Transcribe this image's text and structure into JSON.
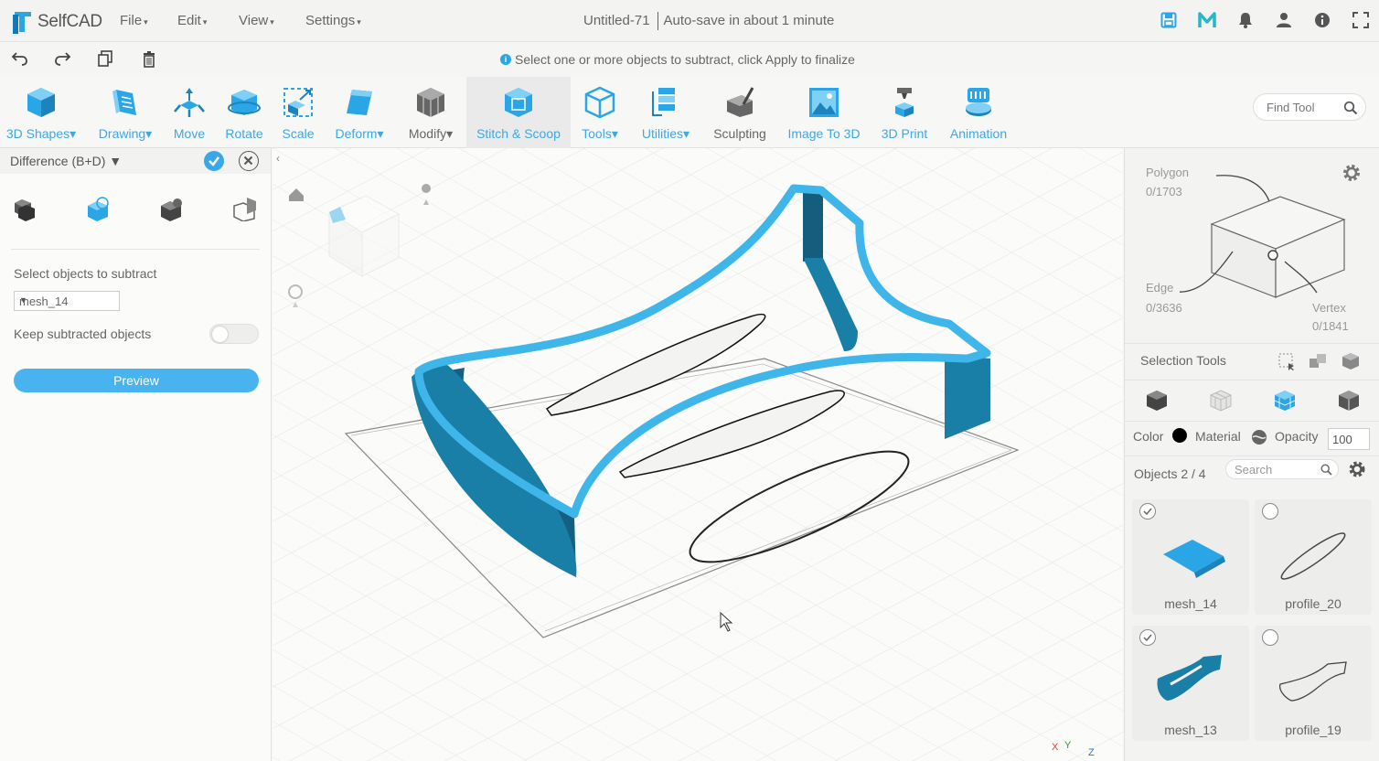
{
  "app": {
    "logo_text": "SelfCAD",
    "menus": [
      "File",
      "Edit",
      "View",
      "Settings"
    ],
    "doc_title": "Untitled-71",
    "autosave": "Auto-save in about 1 minute",
    "top_icons": [
      "save-icon",
      "m-icon",
      "bell-icon",
      "user-icon",
      "info-icon",
      "fullscreen-icon"
    ]
  },
  "actionbar": {
    "hint": "Select one or more objects to subtract, click Apply to finalize",
    "icons": [
      "undo-icon",
      "redo-icon",
      "copy-icon",
      "trash-icon"
    ]
  },
  "toolbar": {
    "tools": [
      {
        "label": "3D Shapes",
        "dropdown": true
      },
      {
        "label": "Drawing",
        "dropdown": true
      },
      {
        "label": "Move",
        "dropdown": false
      },
      {
        "label": "Rotate",
        "dropdown": false
      },
      {
        "label": "Scale",
        "dropdown": false
      },
      {
        "label": "Deform",
        "dropdown": true
      },
      {
        "label": "Modify",
        "dropdown": true
      },
      {
        "label": "Stitch & Scoop",
        "dropdown": false
      },
      {
        "label": "Tools",
        "dropdown": true
      },
      {
        "label": "Utilities",
        "dropdown": true
      },
      {
        "label": "Sculpting",
        "dropdown": false
      },
      {
        "label": "Image To 3D",
        "dropdown": false
      },
      {
        "label": "3D Print",
        "dropdown": false
      },
      {
        "label": "Animation",
        "dropdown": false
      }
    ],
    "find_tool_placeholder": "Find Tool"
  },
  "left_panel": {
    "title": "Difference (B+D)",
    "select_label": "Select objects to subtract",
    "selected_object": "mesh_14",
    "keep_label": "Keep subtracted objects",
    "keep_enabled": false,
    "preview_label": "Preview"
  },
  "right_panel": {
    "polygon_label": "Polygon",
    "polygon_count": "0/1703",
    "edge_label": "Edge",
    "edge_count": "0/3636",
    "vertex_label": "Vertex",
    "vertex_count": "0/1841",
    "selection_tools_label": "Selection Tools",
    "color_label": "Color",
    "color_value": "#000000",
    "material_label": "Material",
    "opacity_label": "Opacity",
    "opacity_value": "100",
    "objects_label": "Objects 2 / 4",
    "search_placeholder": "Search",
    "objects": [
      {
        "name": "mesh_14",
        "checked": true
      },
      {
        "name": "profile_20",
        "checked": false
      },
      {
        "name": "mesh_13",
        "checked": true
      },
      {
        "name": "profile_19",
        "checked": false
      }
    ]
  },
  "viewport": {
    "axis_labels": [
      "X",
      "Y",
      "Z"
    ]
  },
  "colors": {
    "accent": "#3aa8e8",
    "mesh": "#1a7fa6",
    "mesh_top": "#3fb6ea"
  }
}
